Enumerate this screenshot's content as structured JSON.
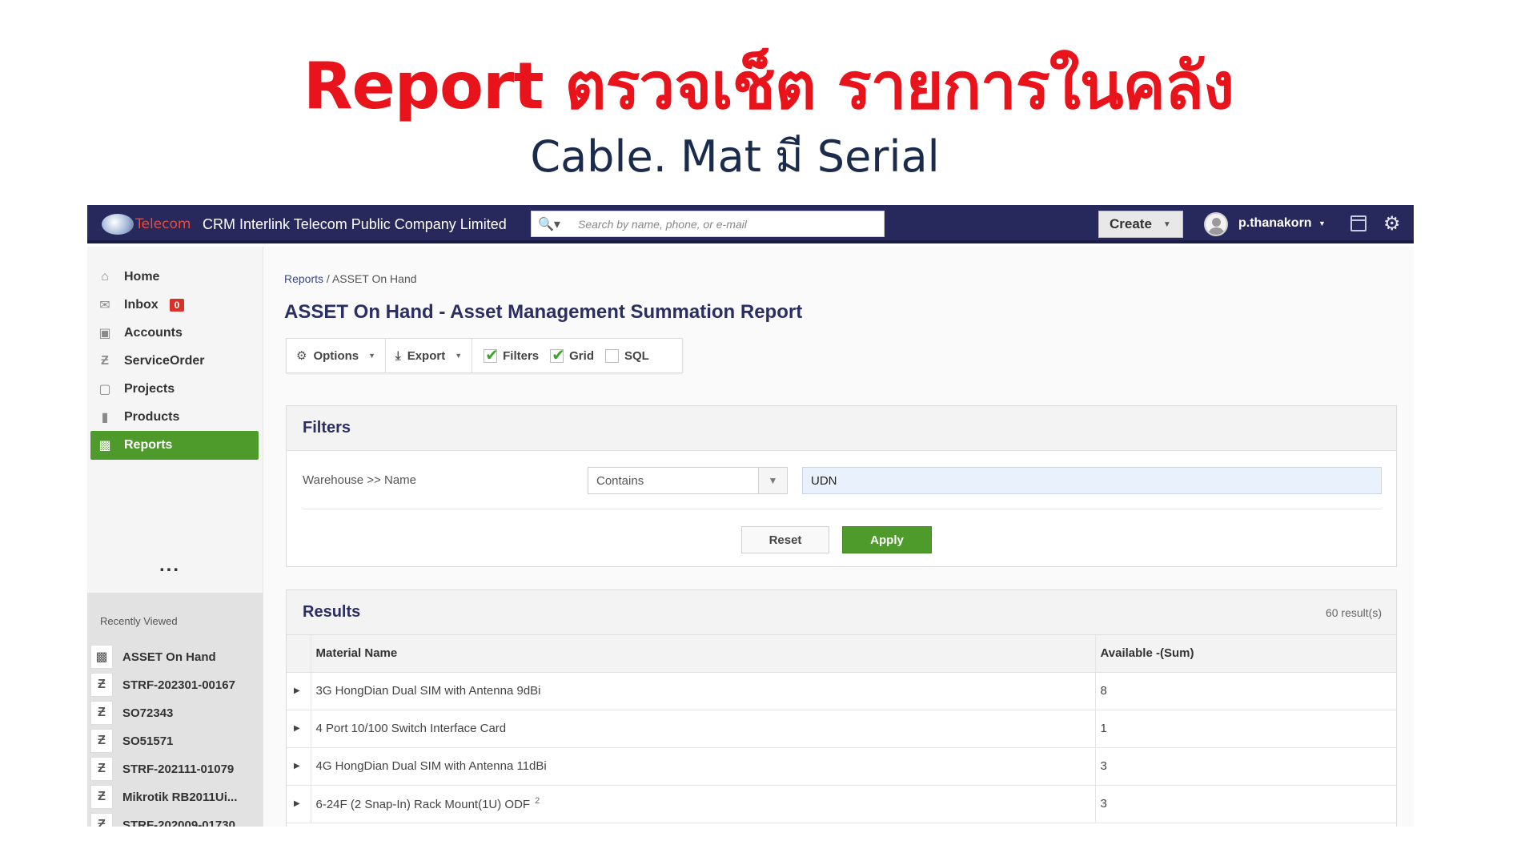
{
  "slide": {
    "title": "Report ตรวจเช็ต รายการในคลัง",
    "subtitle": "Cable. Mat มี Serial"
  },
  "topbar": {
    "logo_text": "Telecom",
    "company": "CRM Interlink Telecom Public Company Limited",
    "search_placeholder": "Search by name, phone, or e-mail",
    "create_label": "Create",
    "username": "p.thanakorn"
  },
  "sidebar": {
    "items": [
      {
        "label": "Home",
        "icon": "home-icon"
      },
      {
        "label": "Inbox",
        "icon": "mail-icon",
        "badge": "0"
      },
      {
        "label": "Accounts",
        "icon": "folder-icon"
      },
      {
        "label": "ServiceOrder",
        "icon": "z-icon"
      },
      {
        "label": "Projects",
        "icon": "briefcase-icon"
      },
      {
        "label": "Products",
        "icon": "book-icon"
      },
      {
        "label": "Reports",
        "icon": "bar-chart-icon",
        "active": true
      }
    ],
    "more": "...",
    "recent_label": "Recently Viewed",
    "recent": [
      {
        "label": "ASSET On Hand",
        "icon": "bar-chart-icon"
      },
      {
        "label": "STRF-202301-00167",
        "icon": "z-icon"
      },
      {
        "label": "SO72343",
        "icon": "z-icon"
      },
      {
        "label": "SO51571",
        "icon": "z-icon"
      },
      {
        "label": "STRF-202111-01079",
        "icon": "z-icon"
      },
      {
        "label": "Mikrotik RB2011Ui...",
        "icon": "z-icon"
      },
      {
        "label": "STRF-202009-01730",
        "icon": "z-icon"
      }
    ]
  },
  "breadcrumb": {
    "parent": "Reports",
    "separator": "/",
    "current": "ASSET On Hand"
  },
  "page_title": "ASSET On Hand - Asset Management Summation Report",
  "toolbar": {
    "options": "Options",
    "export": "Export",
    "filters": "Filters",
    "filters_checked": true,
    "grid": "Grid",
    "grid_checked": true,
    "sql": "SQL",
    "sql_checked": false
  },
  "filters": {
    "header": "Filters",
    "field_label": "Warehouse >> Name",
    "operator": "Contains",
    "value": "UDN",
    "reset_label": "Reset",
    "apply_label": "Apply"
  },
  "results": {
    "header": "Results",
    "count": "60 result(s)",
    "columns": [
      "Material Name",
      "Available -(Sum)"
    ],
    "rows": [
      {
        "name": "3G HongDian Dual SIM with Antenna 9dBi",
        "available": "8"
      },
      {
        "name": "4 Port 10/100 Switch Interface Card",
        "available": "1"
      },
      {
        "name": "4G HongDian Dual SIM with Antenna 11dBi",
        "available": "3"
      },
      {
        "name": "6-24F (2 Snap-In) Rack Mount(1U) ODF",
        "note": "2",
        "available": "3"
      }
    ]
  }
}
